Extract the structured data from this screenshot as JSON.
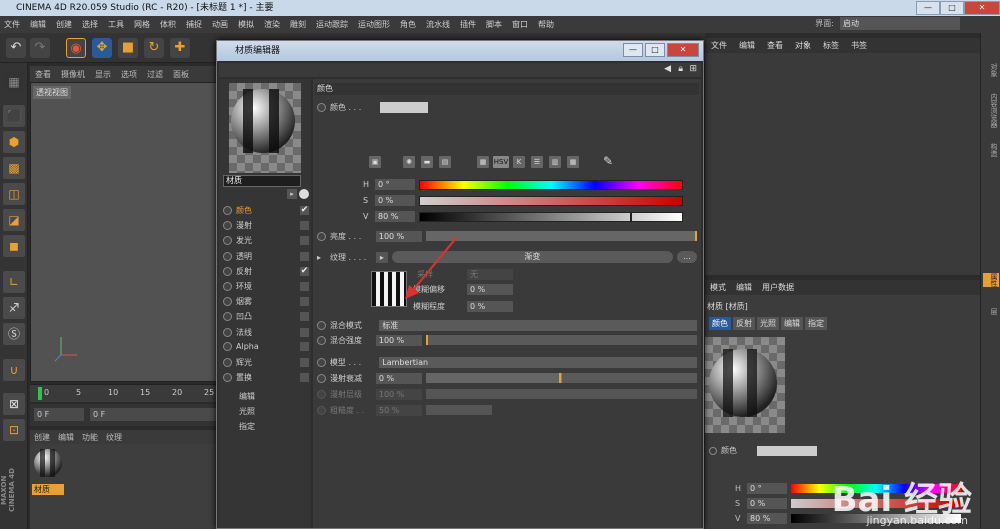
{
  "app": {
    "title": "CINEMA 4D R20.059 Studio (RC - R20) - [未标题 1 *] - 主要",
    "win_min": "—",
    "win_max": "□",
    "win_close": "✕"
  },
  "menubar": [
    "文件",
    "编辑",
    "创建",
    "选择",
    "工具",
    "网格",
    "体积",
    "捕捉",
    "动画",
    "模拟",
    "渲染",
    "雕刻",
    "运动跟踪",
    "运动图形",
    "角色",
    "流水线",
    "插件",
    "脚本",
    "窗口",
    "帮助"
  ],
  "layout": {
    "label": "界面:",
    "value": "启动"
  },
  "viewport": {
    "menu": [
      "查看",
      "摄像机",
      "显示",
      "选项",
      "过滤",
      "面板"
    ],
    "label": "透视视图"
  },
  "timeline": {
    "ticks": [
      "0",
      "5",
      "10",
      "15",
      "20",
      "25"
    ],
    "frame_a": "0 F",
    "frame_b": "0 F"
  },
  "material_manager": {
    "menu": [
      "创建",
      "编辑",
      "功能",
      "纹理"
    ],
    "material_name": "材质"
  },
  "maxon": "MAXON CINEMA 4D",
  "object_manager": {
    "menu": [
      "文件",
      "编辑",
      "查看",
      "对象",
      "标签",
      "书签"
    ]
  },
  "right_strip": [
    "对象",
    "内容浏览器",
    "构造",
    "属性",
    "层"
  ],
  "attribute_manager": {
    "menu": [
      "模式",
      "编辑",
      "用户数据"
    ],
    "header": "材质 [材质]",
    "tabs": [
      "颜色",
      "反射",
      "光照",
      "编辑",
      "指定"
    ],
    "color_label": "颜色",
    "h_label": "H",
    "h_value": "0 °",
    "s_label": "S",
    "s_value": "0 %",
    "v_label": "V",
    "v_value": "80 %"
  },
  "dialog": {
    "title": "材质编辑器",
    "min": "—",
    "max": "□",
    "close": "✕",
    "material_name": "材质",
    "channels": [
      {
        "name": "颜色",
        "checked": "✔"
      },
      {
        "name": "漫射",
        "checked": ""
      },
      {
        "name": "发光",
        "checked": ""
      },
      {
        "name": "透明",
        "checked": ""
      },
      {
        "name": "反射",
        "checked": "✔"
      },
      {
        "name": "环境",
        "checked": ""
      },
      {
        "name": "烟雾",
        "checked": ""
      },
      {
        "name": "凹凸",
        "checked": ""
      },
      {
        "name": "法线",
        "checked": ""
      },
      {
        "name": "Alpha",
        "checked": ""
      },
      {
        "name": "辉光",
        "checked": ""
      },
      {
        "name": "置换",
        "checked": ""
      }
    ],
    "extra": [
      "编辑",
      "光照",
      "指定"
    ],
    "section": "颜色",
    "color_label": "颜色 . . .",
    "hsv_btn": "HSV",
    "h_label": "H",
    "h_value": "0 °",
    "s_label": "S",
    "s_value": "0 %",
    "v_label": "V",
    "v_value": "80 %",
    "brightness_label": "亮度 . . .",
    "brightness_value": "100 %",
    "texture_label": "纹理 . . . .",
    "texture_value": "渐变",
    "texture_more": "...",
    "sampling_label": "采样",
    "sampling_value": "无",
    "blur_offset_label": "模糊偏移",
    "blur_offset_value": "0 %",
    "blur_scale_label": "模糊程度",
    "blur_scale_value": "0 %",
    "mix_mode_label": "混合模式",
    "mix_mode_value": "标准",
    "mix_strength_label": "混合强度",
    "mix_strength_value": "100 %",
    "model_label": "模型 . . .",
    "model_value": "Lambertian",
    "diffuse_falloff_label": "漫射衰减",
    "diffuse_falloff_value": "0 %",
    "diffuse_level_label": "漫射层级",
    "diffuse_level_value": "100 %",
    "roughness_label": "粗糙度 . .",
    "roughness_value": "50 %"
  },
  "watermark": {
    "brand": "Bai 经验",
    "url": "jingyan.baidu.com"
  }
}
